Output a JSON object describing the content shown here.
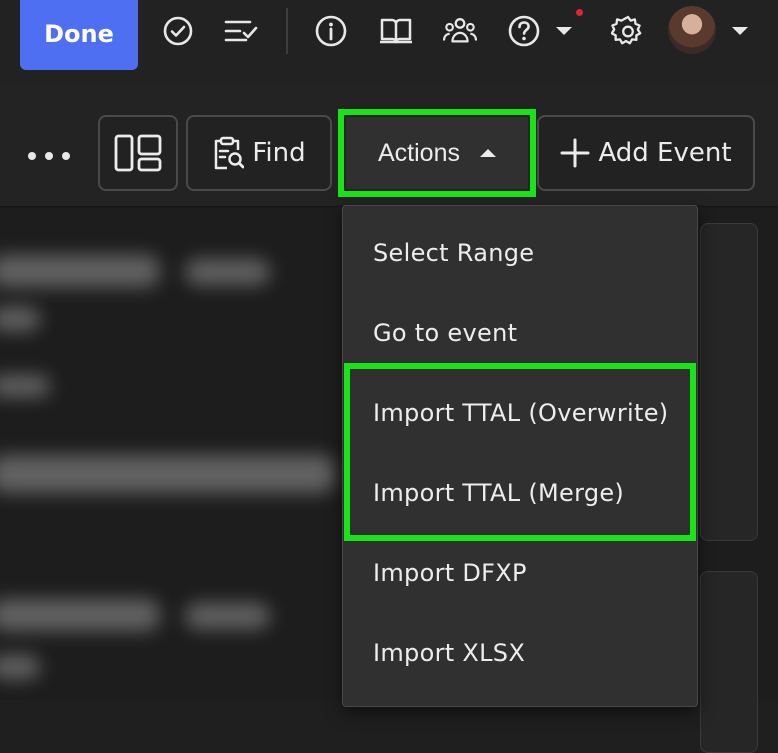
{
  "topbar": {
    "done_label": "Done",
    "icons": [
      "check-circle-icon",
      "checklist-icon",
      "info-icon",
      "book-icon",
      "users-icon",
      "help-icon",
      "settings-icon"
    ],
    "notification_color": "#e0262d"
  },
  "toolbar": {
    "find_label": "Find",
    "actions_label": "Actions",
    "add_event_label": "Add Event"
  },
  "actions_menu": {
    "items": [
      {
        "label": "Select Range"
      },
      {
        "label": "Go to event"
      },
      {
        "label": "Import TTAL (Overwrite)"
      },
      {
        "label": "Import TTAL (Merge)"
      },
      {
        "label": "Import DFXP"
      },
      {
        "label": "Import XLSX"
      }
    ]
  },
  "colors": {
    "done_button": "#4e6ff2",
    "highlight": "#19e319",
    "background": "#1f1f1f",
    "menu": "#303030"
  }
}
